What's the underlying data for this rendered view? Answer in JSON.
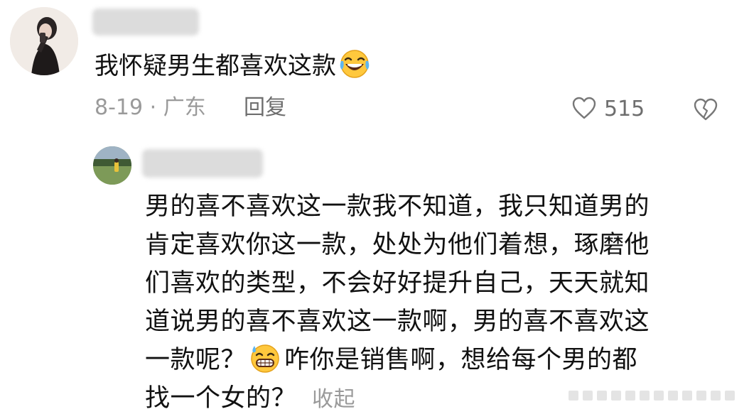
{
  "comment": {
    "text": "我怀疑男生都喜欢这款",
    "emoji": "laughing-crying-emoji",
    "date_location": "8-19 · 广东",
    "reply_label": "回复",
    "like_count": "515"
  },
  "reply": {
    "lines": [
      "男的喜不喜欢这一款我不知道，我只知道男的",
      "肯定喜欢你这一款，处处为他们着想，琢磨他",
      "们喜欢的类型，不会好好提升自己，天天就知",
      "道说男的喜不喜欢这一款啊，男的喜不喜欢这",
      "一款呢？",
      "咋你是销售啊，想给每个男的都",
      "找一个女的？"
    ],
    "emoji": "sweat-smile-emoji",
    "collapse_label": "收起"
  },
  "icons": {
    "like": "heart-outline-icon",
    "dislike": "broken-heart-icon"
  },
  "colors": {
    "text_primary": "#111111",
    "text_secondary": "#9a9a9a",
    "text_action": "#6e6e6e",
    "emoji_face": "#ffc83d"
  }
}
